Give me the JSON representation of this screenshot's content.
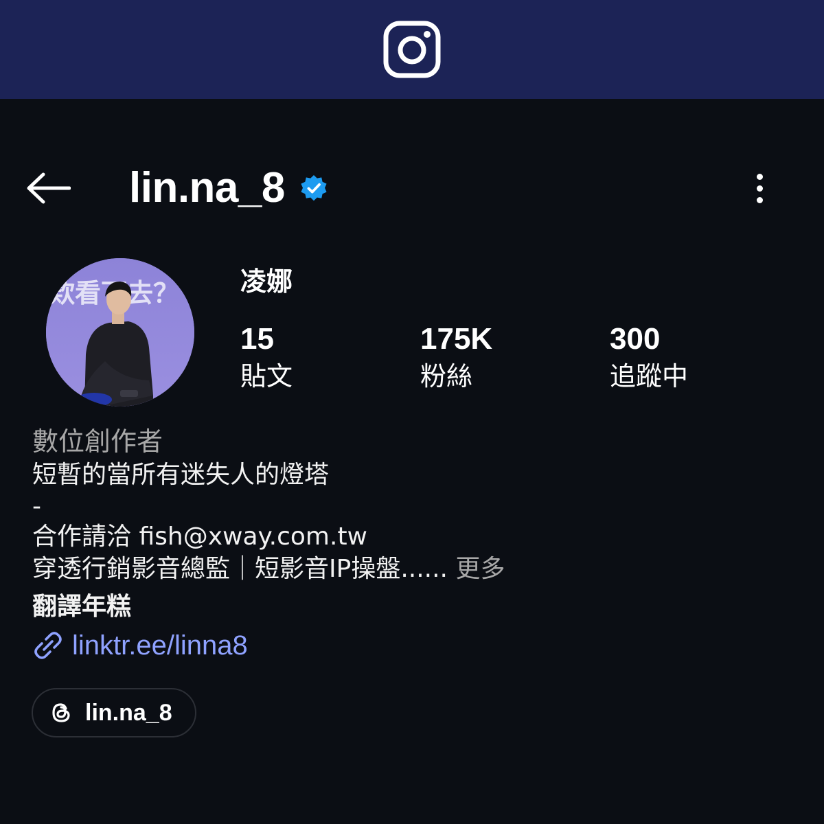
{
  "header": {
    "logo_icon": "instagram-logo",
    "bg_color": "#1c2356"
  },
  "topbar": {
    "back_icon": "arrow-left-icon",
    "username": "lin.na_8",
    "verified_icon": "verified-badge-icon",
    "verified_color": "#1d9bf0",
    "more_icon": "more-vertical-icon"
  },
  "profile": {
    "display_name": "凌娜",
    "avatar_caption": "欸看下去？",
    "stats": [
      {
        "value": "15",
        "label": "貼文"
      },
      {
        "value": "175K",
        "label": "粉絲"
      },
      {
        "value": "300",
        "label": "追蹤中"
      }
    ]
  },
  "bio": {
    "category": "數位創作者",
    "line1": "短暫的當所有迷失人的燈塔",
    "dash": "-",
    "contact": "合作請洽 fish@xway.com.tw",
    "role": "穿透行銷影音總監｜短影音IP操盤......",
    "more": " 更多",
    "bold_name": "翻譯年糕",
    "link_icon": "link-icon",
    "link": "linktr.ee/linna8",
    "link_color": "#8fa2ff"
  },
  "threads": {
    "icon": "threads-icon",
    "handle": "lin.na_8"
  }
}
